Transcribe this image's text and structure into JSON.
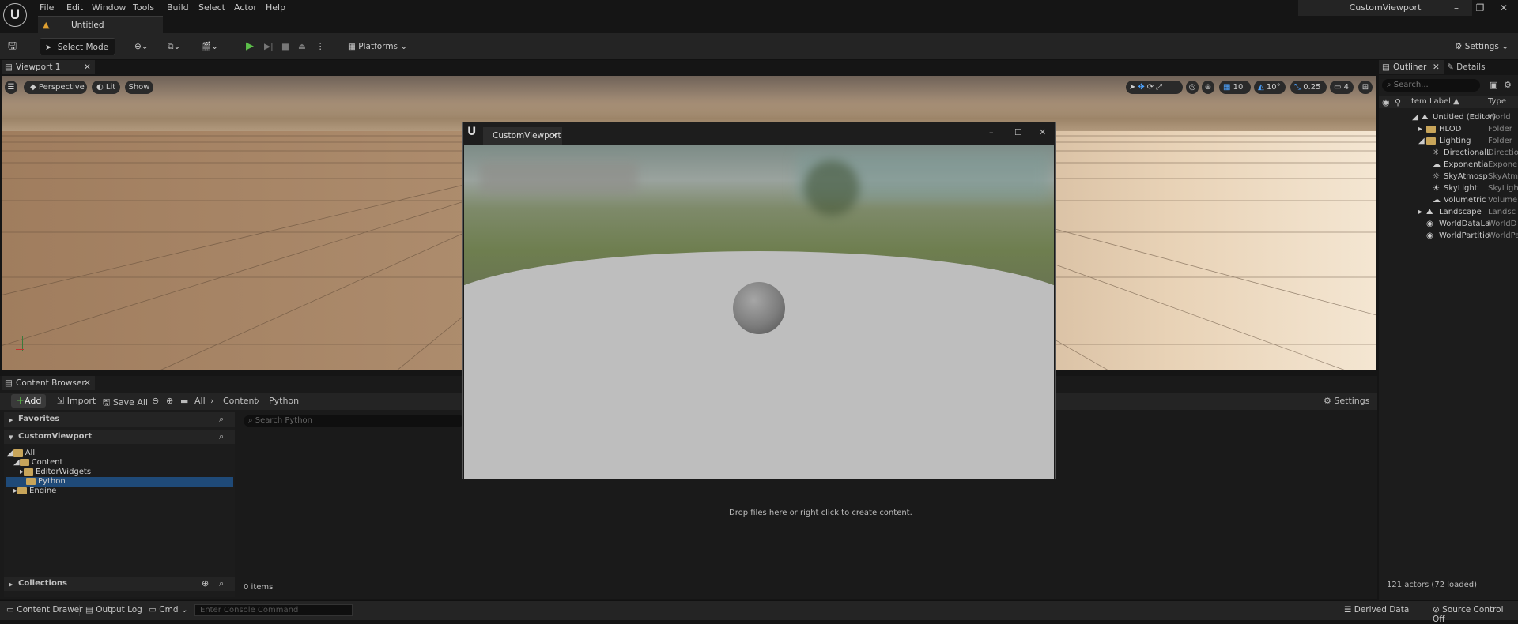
{
  "menu": [
    "File",
    "Edit",
    "Window",
    "Tools",
    "Build",
    "Select",
    "Actor",
    "Help"
  ],
  "app_title": "CustomViewport",
  "doc_tab": "Untitled",
  "toolbar": {
    "select_mode": "Select Mode",
    "platforms": "Platforms",
    "settings": "Settings"
  },
  "viewport": {
    "tab": "Viewport 1",
    "perspective": "Perspective",
    "lit": "Lit",
    "show": "Show",
    "grid_snap": "10",
    "rot_snap": "10°",
    "scale_snap": "0.25",
    "cam_speed": "4"
  },
  "custom_window": {
    "title": "CustomViewport"
  },
  "content_browser": {
    "tab": "Content Browser",
    "add": "Add",
    "import": "Import",
    "save_all": "Save All",
    "breadcrumb": [
      "All",
      "Content",
      "Python"
    ],
    "settings": "Settings",
    "favorites": "Favorites",
    "project": "CustomViewport",
    "tree": [
      "All",
      "Content",
      "EditorWidgets",
      "Python",
      "Engine"
    ],
    "search_placeholder": "Search Python",
    "empty_msg": "Drop files here or right click to create content.",
    "items_count": "0 items",
    "collections": "Collections"
  },
  "outliner": {
    "tab": "Outliner",
    "details_tab": "Details",
    "search_placeholder": "Search...",
    "col_label": "Item Label ▲",
    "col_type": "Type",
    "rows": [
      {
        "label": "Untitled (Editor)",
        "type": "World"
      },
      {
        "label": "HLOD",
        "type": "Folder"
      },
      {
        "label": "Lighting",
        "type": "Folder"
      },
      {
        "label": "DirectionalL",
        "type": "Directio"
      },
      {
        "label": "Exponentia",
        "type": "Exponen"
      },
      {
        "label": "SkyAtmosp",
        "type": "SkyAtm"
      },
      {
        "label": "SkyLight",
        "type": "SkyLigh"
      },
      {
        "label": "Volumetric",
        "type": "Volume"
      },
      {
        "label": "Landscape",
        "type": "Landsc"
      },
      {
        "label": "WorldDataLa",
        "type": "WorldD"
      },
      {
        "label": "WorldPartitio",
        "type": "WorldPa"
      }
    ],
    "actors": "121 actors (72 loaded)"
  },
  "statusbar": {
    "content_drawer": "Content Drawer",
    "output_log": "Output Log",
    "cmd": "Cmd",
    "console_placeholder": "Enter Console Command",
    "derived_data": "Derived Data",
    "source_control": "Source Control Off"
  }
}
